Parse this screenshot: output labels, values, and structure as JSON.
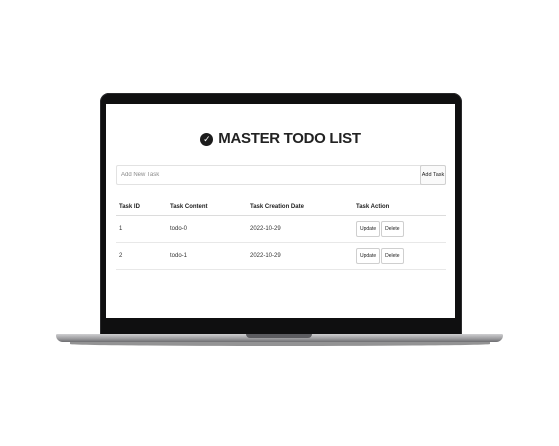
{
  "app": {
    "title": "MASTER TODO LIST",
    "title_icon": "check-circle-icon"
  },
  "add_task": {
    "placeholder": "Add New Task",
    "value": "",
    "button_label": "Add Task"
  },
  "table": {
    "headers": [
      "Task ID",
      "Task Content",
      "Task Creation Date",
      "Task Action"
    ],
    "rows": [
      {
        "id": "1",
        "content": "todo-0",
        "date": "2022-10-29",
        "update_label": "Update",
        "delete_label": "Delete"
      },
      {
        "id": "2",
        "content": "todo-1",
        "date": "2022-10-29",
        "update_label": "Update",
        "delete_label": "Delete"
      }
    ]
  },
  "colors": {
    "bezel": "#0f0f10",
    "screen": "#ffffff",
    "text": "#222222"
  }
}
